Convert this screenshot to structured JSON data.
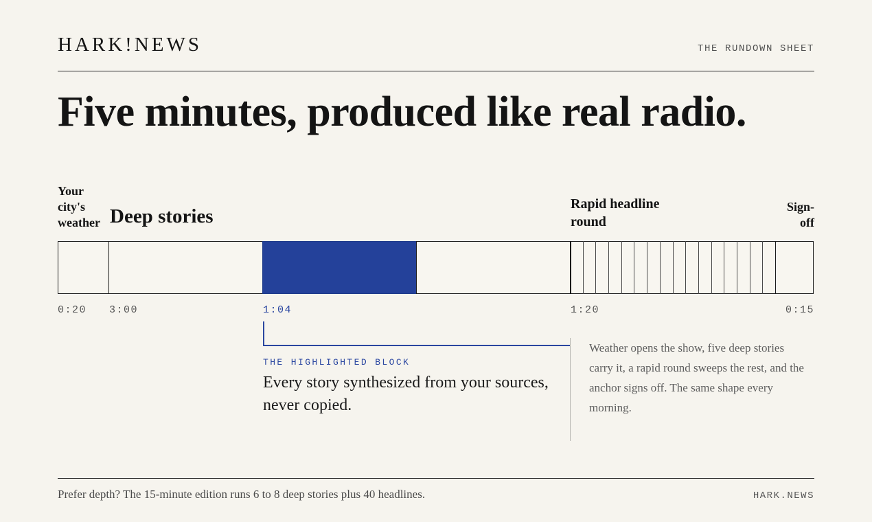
{
  "header": {
    "logo": "HARK!NEWS",
    "sheet_label": "THE RUNDOWN SHEET"
  },
  "headline": "Five minutes, produced like real radio.",
  "rundown": {
    "segments": [
      {
        "label": "Your city's weather",
        "duration": "0:20"
      },
      {
        "label": "Deep stories",
        "duration": "3:00"
      },
      {
        "label": "",
        "duration": "1:04",
        "highlighted": true
      },
      {
        "label": "Rapid headline round",
        "duration": "1:20"
      },
      {
        "label": "Sign-off",
        "duration": "0:15"
      }
    ],
    "highlight_color": "#24419a"
  },
  "callout": {
    "kicker": "THE HIGHLIGHTED BLOCK",
    "text": "Every story synthesized from your sources, never copied."
  },
  "side_note": "Weather opens the show, five deep stories carry it, a rapid round sweeps the rest, and the anchor signs off. The same shape every morning.",
  "footer": {
    "text": "Prefer depth? The 15-minute edition runs 6 to 8 deep stories plus 40 headlines.",
    "link": "HARK.NEWS"
  }
}
